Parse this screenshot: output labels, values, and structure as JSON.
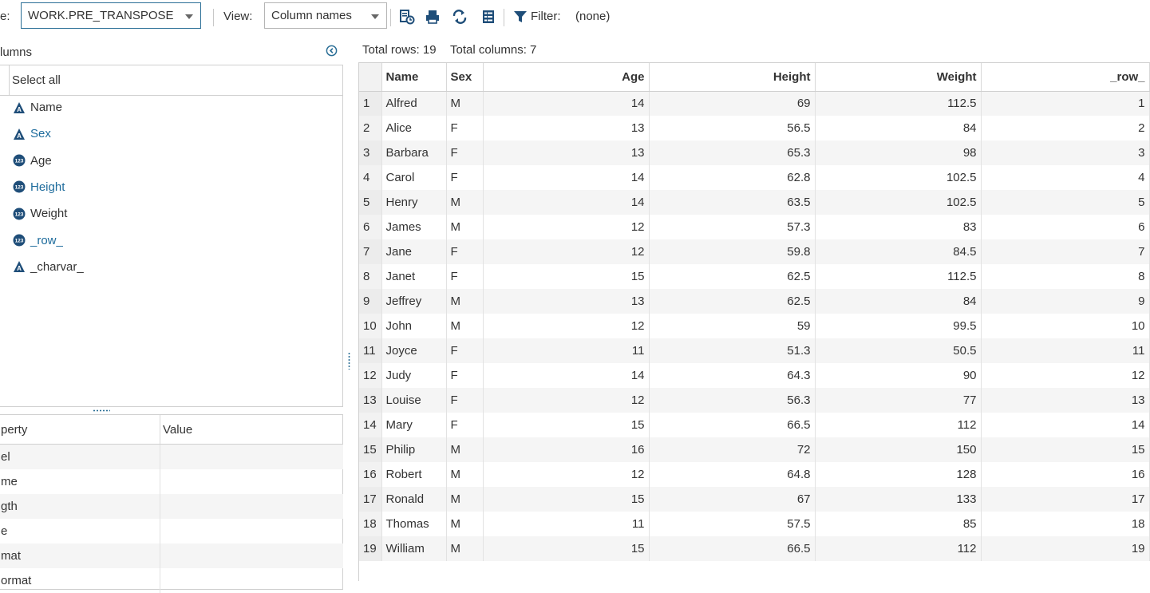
{
  "toolbar": {
    "table_label": "e:",
    "table_value": "WORK.PRE_TRANSPOSE",
    "view_label": "View:",
    "view_value": "Column names",
    "filter_label": "Filter:",
    "filter_value": "(none)",
    "icons": [
      "refresh-data-icon",
      "print-icon",
      "swap-icon",
      "columns-list-icon",
      "filter-icon"
    ]
  },
  "columns_panel": {
    "title": "lumns",
    "select_all": "Select all",
    "items": [
      {
        "name": "Name",
        "type": "char"
      },
      {
        "name": "Sex",
        "type": "char"
      },
      {
        "name": "Age",
        "type": "num"
      },
      {
        "name": "Height",
        "type": "num"
      },
      {
        "name": "Weight",
        "type": "num"
      },
      {
        "name": "_row_",
        "type": "num"
      },
      {
        "name": "_charvar_",
        "type": "char"
      }
    ]
  },
  "properties": {
    "header_property": "perty",
    "header_value": "Value",
    "rows": [
      "el",
      "me",
      "gth",
      "e",
      "mat",
      "ormat"
    ]
  },
  "summary": {
    "total_rows": "Total rows: 19",
    "total_columns": "Total columns: 7"
  },
  "grid": {
    "headers": [
      "Name",
      "Sex",
      "Age",
      "Height",
      "Weight",
      "_row_"
    ],
    "rows": [
      [
        "1",
        "Alfred",
        "M",
        "14",
        "69",
        "112.5",
        "1"
      ],
      [
        "2",
        "Alice",
        "F",
        "13",
        "56.5",
        "84",
        "2"
      ],
      [
        "3",
        "Barbara",
        "F",
        "13",
        "65.3",
        "98",
        "3"
      ],
      [
        "4",
        "Carol",
        "F",
        "14",
        "62.8",
        "102.5",
        "4"
      ],
      [
        "5",
        "Henry",
        "M",
        "14",
        "63.5",
        "102.5",
        "5"
      ],
      [
        "6",
        "James",
        "M",
        "12",
        "57.3",
        "83",
        "6"
      ],
      [
        "7",
        "Jane",
        "F",
        "12",
        "59.8",
        "84.5",
        "7"
      ],
      [
        "8",
        "Janet",
        "F",
        "15",
        "62.5",
        "112.5",
        "8"
      ],
      [
        "9",
        "Jeffrey",
        "M",
        "13",
        "62.5",
        "84",
        "9"
      ],
      [
        "10",
        "John",
        "M",
        "12",
        "59",
        "99.5",
        "10"
      ],
      [
        "11",
        "Joyce",
        "F",
        "11",
        "51.3",
        "50.5",
        "11"
      ],
      [
        "12",
        "Judy",
        "F",
        "14",
        "64.3",
        "90",
        "12"
      ],
      [
        "13",
        "Louise",
        "F",
        "12",
        "56.3",
        "77",
        "13"
      ],
      [
        "14",
        "Mary",
        "F",
        "15",
        "66.5",
        "112",
        "14"
      ],
      [
        "15",
        "Philip",
        "M",
        "16",
        "72",
        "150",
        "15"
      ],
      [
        "16",
        "Robert",
        "M",
        "12",
        "64.8",
        "128",
        "16"
      ],
      [
        "17",
        "Ronald",
        "M",
        "15",
        "67",
        "133",
        "17"
      ],
      [
        "18",
        "Thomas",
        "M",
        "11",
        "57.5",
        "85",
        "18"
      ],
      [
        "19",
        "William",
        "M",
        "15",
        "66.5",
        "112",
        "19"
      ]
    ]
  },
  "colors": {
    "accent": "#2a6e96",
    "link": "#1d6b9c",
    "icon_dark": "#1f4e79"
  }
}
